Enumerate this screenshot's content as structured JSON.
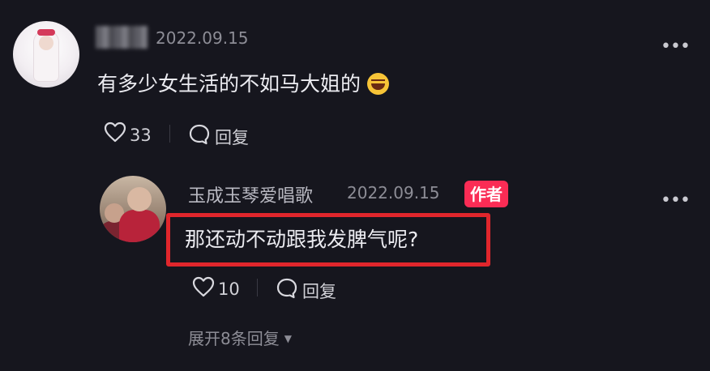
{
  "comment": {
    "date": "2022.09.15",
    "text": "有多少女生活的不如马大姐的",
    "emoji_icon": "rofl-emoji",
    "likes": "33",
    "reply_label": "回复",
    "more_icon": "•••"
  },
  "reply": {
    "username": "玉成玉琴爱唱歌",
    "date": "2022.09.15",
    "badge": "作者",
    "text": "那还动不动跟我发脾气呢?",
    "likes": "10",
    "reply_label": "回复",
    "more_icon": "•••"
  },
  "expand": {
    "label": "展开8条回复",
    "caret": "▼"
  },
  "colors": {
    "background": "#16161e",
    "badge": "#fa2c55",
    "highlight_box": "#e0262c"
  }
}
